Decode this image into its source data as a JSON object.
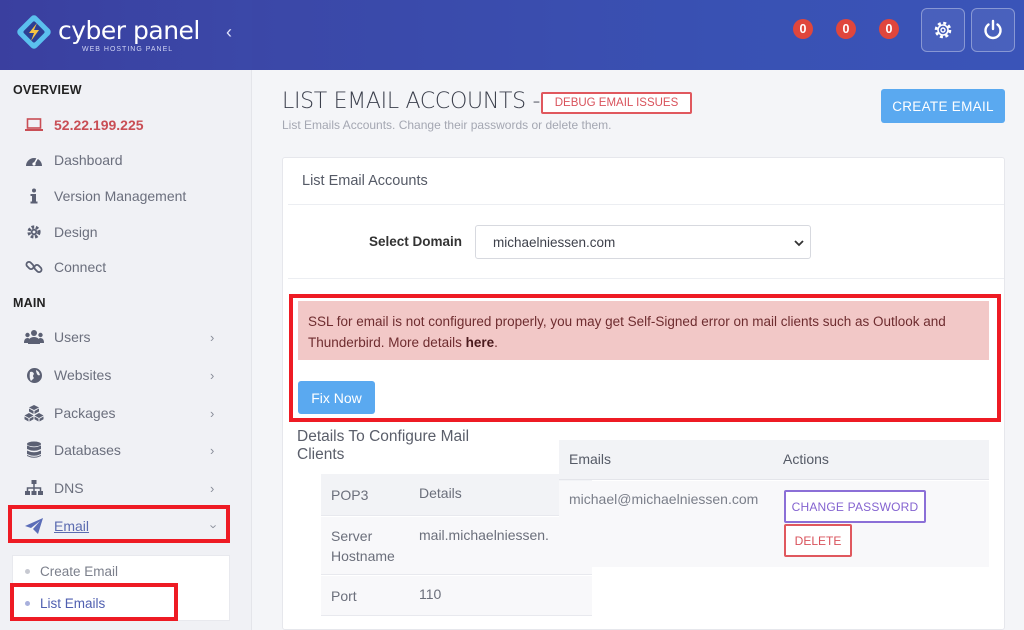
{
  "brand": {
    "name": "cyber panel",
    "tagline": "WEB HOSTING PANEL"
  },
  "topbar": {
    "badges": [
      "0",
      "0",
      "0"
    ]
  },
  "sidebar": {
    "overview_heading": "OVERVIEW",
    "ip": "52.22.199.225",
    "overview_items": [
      "Dashboard",
      "Version Management",
      "Design",
      "Connect"
    ],
    "main_heading": "MAIN",
    "main_items": [
      "Users",
      "Websites",
      "Packages",
      "Databases",
      "DNS",
      "Email"
    ],
    "email_submenu": [
      "Create Email",
      "List Emails"
    ]
  },
  "page": {
    "title": "LIST EMAIL ACCOUNTS -",
    "debug_button": "DEBUG EMAIL ISSUES",
    "subtitle": "List Emails Accounts. Change their passwords or delete them.",
    "create_button": "CREATE EMAIL"
  },
  "card": {
    "heading": "List Email Accounts",
    "select_label": "Select Domain",
    "selected_domain": "michaelniessen.com",
    "alert_text": "SSL for email is not configured properly, you may get Self-Signed error on mail clients such as Outlook and Thunderbird. More details ",
    "alert_link": "here",
    "alert_end": ".",
    "fix_button": "Fix Now",
    "details_heading": "Details To Configure Mail Clients",
    "config": {
      "headers": [
        "POP3",
        "Details"
      ],
      "rows": [
        {
          "label": "Server Hostname",
          "value": "mail.michaelniessen.com"
        },
        {
          "label": "Port",
          "value": "110"
        }
      ]
    },
    "emails": {
      "headers": [
        "Emails",
        "Actions"
      ],
      "rows": [
        {
          "address": "michael@michaelniessen.com"
        }
      ],
      "change_password": "CHANGE PASSWORD",
      "delete": "DELETE"
    }
  },
  "colors": {
    "accent": "#5aa9f0",
    "topbar": "#3b47a7",
    "highlight": "#ee1b24",
    "alert_bg": "#f2c8c7"
  }
}
